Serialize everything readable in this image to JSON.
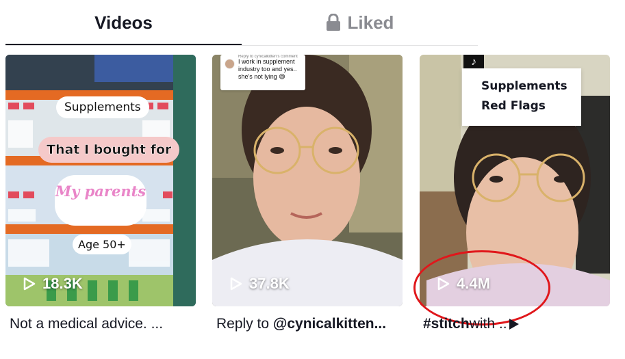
{
  "tabs": {
    "videos_label": "Videos",
    "liked_label": "Liked"
  },
  "videos": [
    {
      "views": "18.3K",
      "overlay": {
        "line1": "Supplements",
        "line2": "That I bought for",
        "line3": "My parents",
        "line4": "Age 50+"
      },
      "caption": "Not a medical advice. ..."
    },
    {
      "views": "37.8K",
      "overlay": {
        "reply_header": "Reply to cynicalkitten's comment",
        "reply_text": "I work in supplement industry too and yes.. she's not lying 😅"
      },
      "caption_prefix": "Reply to ",
      "caption_handle": "@cynicalkitten..."
    },
    {
      "views": "4.4M",
      "overlay": {
        "logo": "♪",
        "line1": "Supplements",
        "line2": "Red Flags"
      },
      "caption_tag": "#stitch",
      "caption_rest": " with .."
    }
  ],
  "colors": {
    "highlight_circle": "#e0171b",
    "tab_active": "#161823",
    "tab_inactive": "#8a8b91"
  }
}
